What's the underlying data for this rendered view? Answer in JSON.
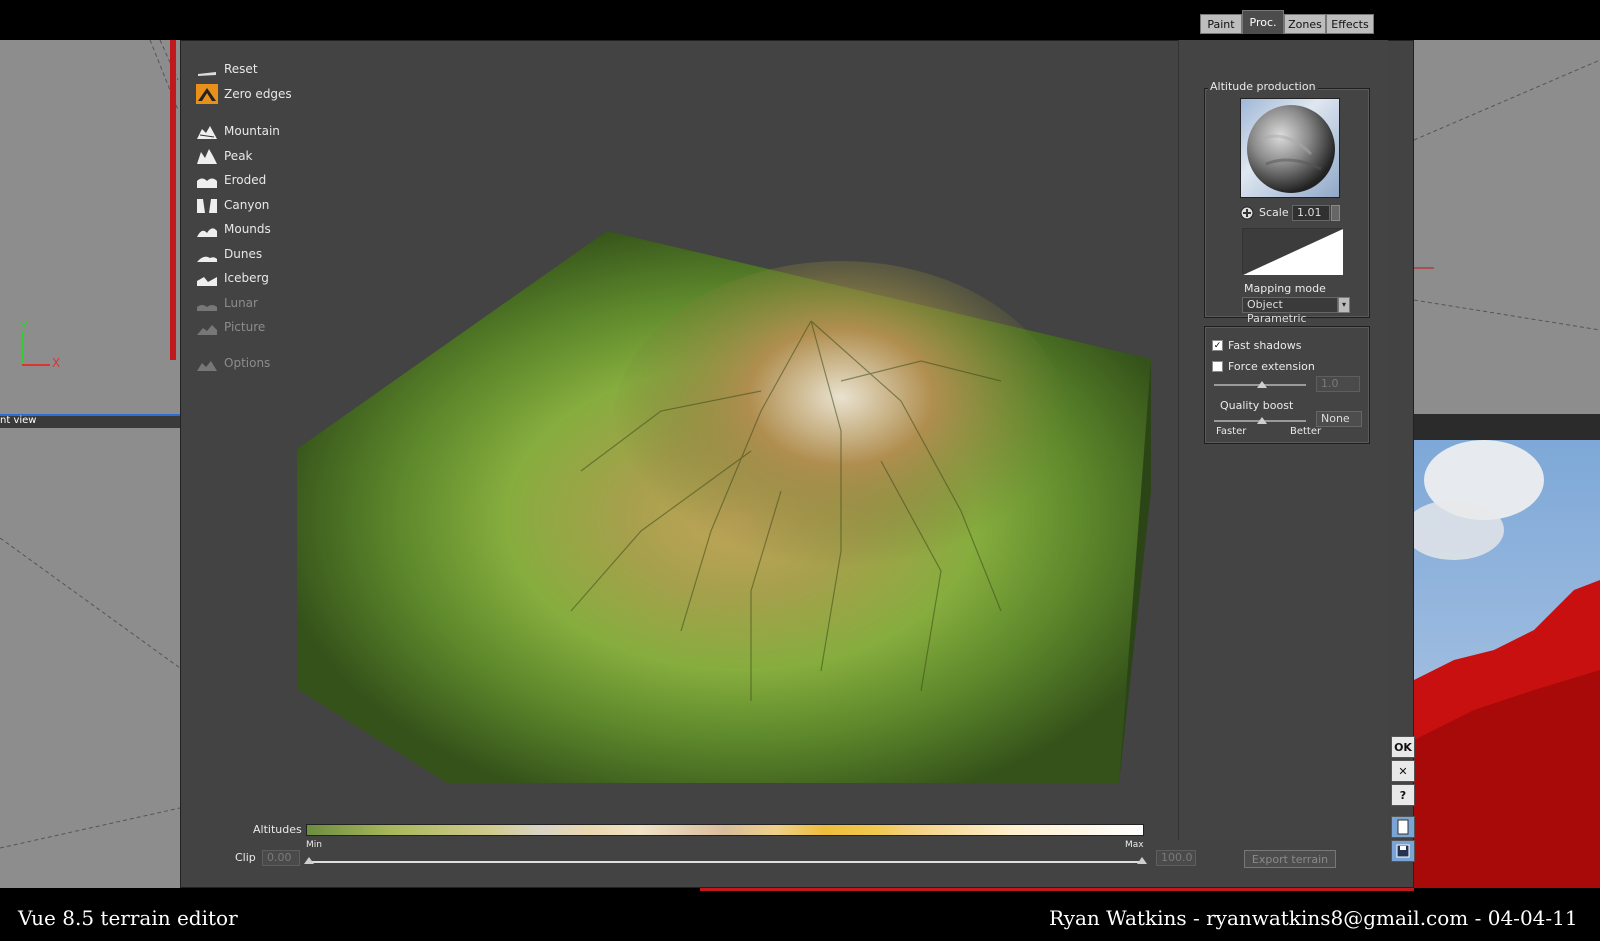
{
  "viewports": {
    "bottom_left_label": "nt view",
    "axis_labels": {
      "y": "Y",
      "x": "X"
    }
  },
  "tool_menu": {
    "items": [
      {
        "label": "Reset",
        "icon": "reset-icon",
        "enabled": true
      },
      {
        "label": "Zero edges",
        "icon": "zero-edges-icon",
        "enabled": true,
        "selected": true
      },
      {
        "label": "Mountain",
        "icon": "mountain-icon",
        "enabled": true
      },
      {
        "label": "Peak",
        "icon": "peak-icon",
        "enabled": true
      },
      {
        "label": "Eroded",
        "icon": "eroded-icon",
        "enabled": true
      },
      {
        "label": "Canyon",
        "icon": "canyon-icon",
        "enabled": true
      },
      {
        "label": "Mounds",
        "icon": "mounds-icon",
        "enabled": true
      },
      {
        "label": "Dunes",
        "icon": "dunes-icon",
        "enabled": true
      },
      {
        "label": "Iceberg",
        "icon": "iceberg-icon",
        "enabled": true
      },
      {
        "label": "Lunar",
        "icon": "lunar-icon",
        "enabled": false
      },
      {
        "label": "Picture",
        "icon": "picture-icon",
        "enabled": false
      },
      {
        "label": "Options",
        "icon": "options-icon",
        "enabled": false
      }
    ]
  },
  "panel": {
    "tabs": [
      "Paint",
      "Proc.",
      "Zones",
      "Effects"
    ],
    "active_tab": "Proc.",
    "altitude_production": {
      "title": "Altitude production",
      "scale_label": "Scale",
      "scale_value": "1.01",
      "mapping_mode_label": "Mapping mode",
      "mapping_mode_value": "Object Parametric"
    },
    "options": {
      "fast_shadows_label": "Fast shadows",
      "fast_shadows_checked": true,
      "force_extension_label": "Force extension",
      "force_extension_checked": false,
      "force_extension_value": "1.0",
      "quality_boost_label": "Quality boost",
      "quality_boost_value": "None",
      "faster_label": "Faster",
      "better_label": "Better"
    }
  },
  "side_buttons": {
    "ok": "OK",
    "close": "✕",
    "help": "?"
  },
  "bottom": {
    "altitudes_label": "Altitudes",
    "min_label": "Min",
    "max_label": "Max",
    "clip_label": "Clip",
    "clip_min": "0.00",
    "clip_max": "100.0",
    "export_label": "Export terrain"
  },
  "captions": {
    "left": "Vue 8.5 terrain editor",
    "right": "Ryan Watkins - ryanwatkins8@gmail.com  - 04-04-11"
  },
  "colors": {
    "accent_red": "#c0181c",
    "viewport_blue": "#2a6fd6",
    "terrain_green": "#4a6e23"
  }
}
